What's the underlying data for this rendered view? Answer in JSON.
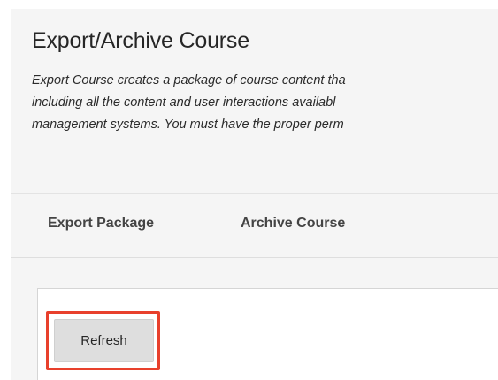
{
  "header": {
    "title": "Export/Archive Course",
    "description_lines": [
      "Export Course creates a package of course content tha",
      "including all the content and user interactions availabl",
      "management systems. You must have the proper perm"
    ]
  },
  "tabs": [
    {
      "label": "Export Package"
    },
    {
      "label": "Archive Course"
    }
  ],
  "actions": {
    "refresh_label": "Refresh"
  },
  "colors": {
    "highlight": "#e8402c",
    "panel_background": "#f5f5f5",
    "button_background": "#dedede"
  }
}
